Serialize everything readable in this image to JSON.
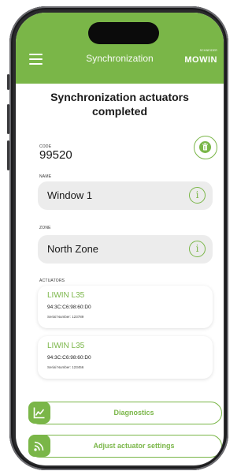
{
  "header": {
    "title": "Synchronization",
    "logo_small": "SCHNEIDER",
    "logo_main": "MOWIN"
  },
  "page_title": "Synchronization actuators completed",
  "code": {
    "label": "CODE",
    "value": "99520"
  },
  "name": {
    "label": "NAME",
    "value": "Window 1"
  },
  "zone": {
    "label": "ZONE",
    "value": "North Zone"
  },
  "actuators": {
    "label": "ACTUATORS",
    "items": [
      {
        "name": "LIWIN L35",
        "mac": "94:3C:C6:98:60:D0",
        "serial": "Serial Number: 123789"
      },
      {
        "name": "LIWIN L35",
        "mac": "94:3C:C6:98:60:D0",
        "serial": "Serial Number: 123456"
      }
    ]
  },
  "buttons": {
    "diagnostics": "Diagnostics",
    "adjust": "Adjust actuator settings"
  },
  "colors": {
    "accent": "#7ab648",
    "field_bg": "#ececec",
    "frame": "#2a2a2c"
  }
}
